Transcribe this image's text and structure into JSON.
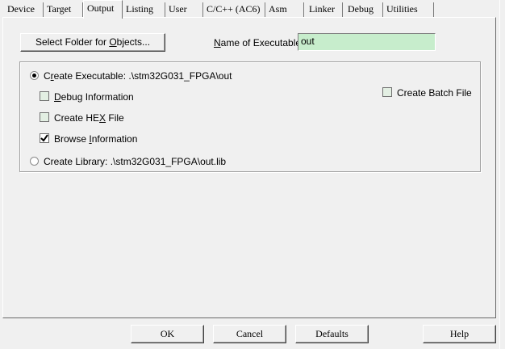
{
  "tabs": [
    {
      "label": "Device",
      "active": false
    },
    {
      "label": "Target",
      "active": false
    },
    {
      "label": "Output",
      "active": true
    },
    {
      "label": "Listing",
      "active": false
    },
    {
      "label": "User",
      "active": false
    },
    {
      "label": "C/C++ (AC6)",
      "active": false
    },
    {
      "label": "Asm",
      "active": false
    },
    {
      "label": "Linker",
      "active": false
    },
    {
      "label": "Debug",
      "active": false
    },
    {
      "label": "Utilities",
      "active": false
    }
  ],
  "output": {
    "select_folder_button": {
      "pre": "Select Folder for ",
      "accel": "O",
      "post": "bjects..."
    },
    "name_label": {
      "accel": "N",
      "post": "ame of Executable:"
    },
    "name_value": "out",
    "create_executable": {
      "pre": "C",
      "accel": "r",
      "post": "eate Executable:  .\\stm32G031_FPGA\\out",
      "selected": true
    },
    "debug_info": {
      "accel": "D",
      "post": "ebug Information",
      "checked": false
    },
    "create_hex": {
      "pre": "Create HE",
      "accel": "X",
      "post": " File",
      "checked": false
    },
    "browse_info": {
      "pre": "Browse ",
      "accel": "I",
      "post": "nformation",
      "checked": true
    },
    "create_library": {
      "text": "Create Library:  .\\stm32G031_FPGA\\out.lib",
      "selected": false
    },
    "create_batch": {
      "text": "Create Batch File",
      "checked": false
    }
  },
  "buttons": {
    "ok": "OK",
    "cancel": "Cancel",
    "defaults": "Defaults",
    "help": "Help"
  }
}
